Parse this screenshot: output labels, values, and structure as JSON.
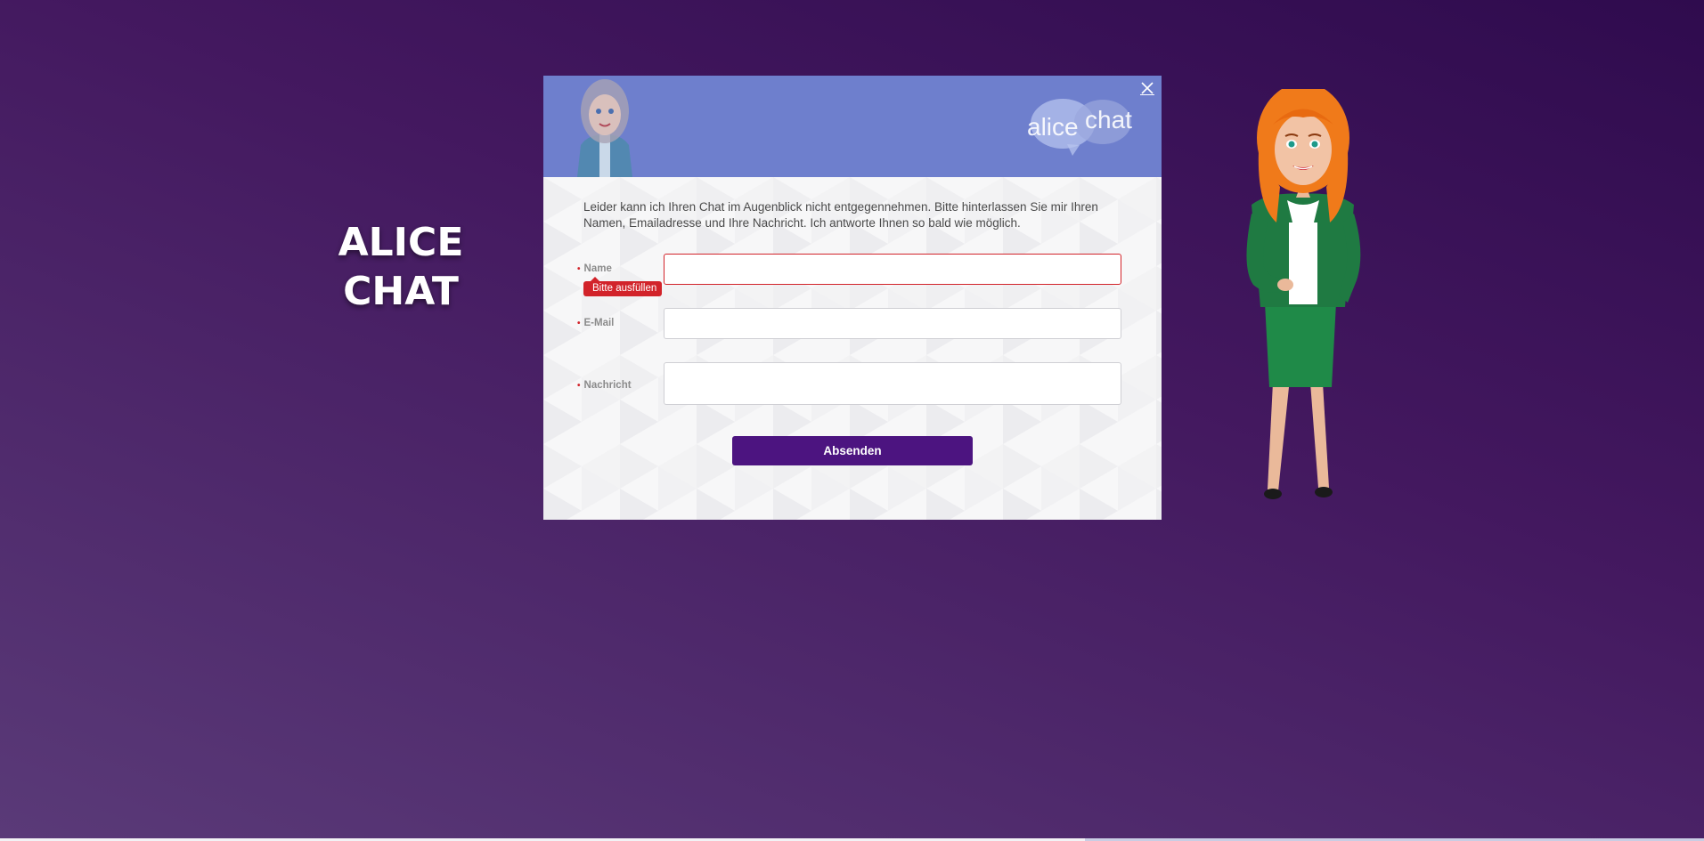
{
  "brand": {
    "line1": "ALICE",
    "line2": "CHAT"
  },
  "dialog": {
    "header": {
      "logo_text_alice": "alice",
      "logo_text_chat": "chat",
      "close_icon": "close-icon"
    },
    "intro": "Leider kann ich Ihren Chat im Augenblick nicht entgegennehmen. Bitte hinterlassen Sie mir Ihren Namen, Emailadresse und Ihre Nachricht. Ich antworte Ihnen so bald wie möglich.",
    "fields": {
      "name": {
        "label": "Name",
        "value": "",
        "error": "Bitte ausfüllen"
      },
      "email": {
        "label": "E-Mail",
        "value": ""
      },
      "message": {
        "label": "Nachricht",
        "value": ""
      }
    },
    "submit_label": "Absenden"
  },
  "colors": {
    "background_top": "#2f0b4e",
    "background_bottom": "#5a3a78",
    "header": "#6e7fcd",
    "submit": "#4c1480",
    "error": "#d2232a"
  }
}
